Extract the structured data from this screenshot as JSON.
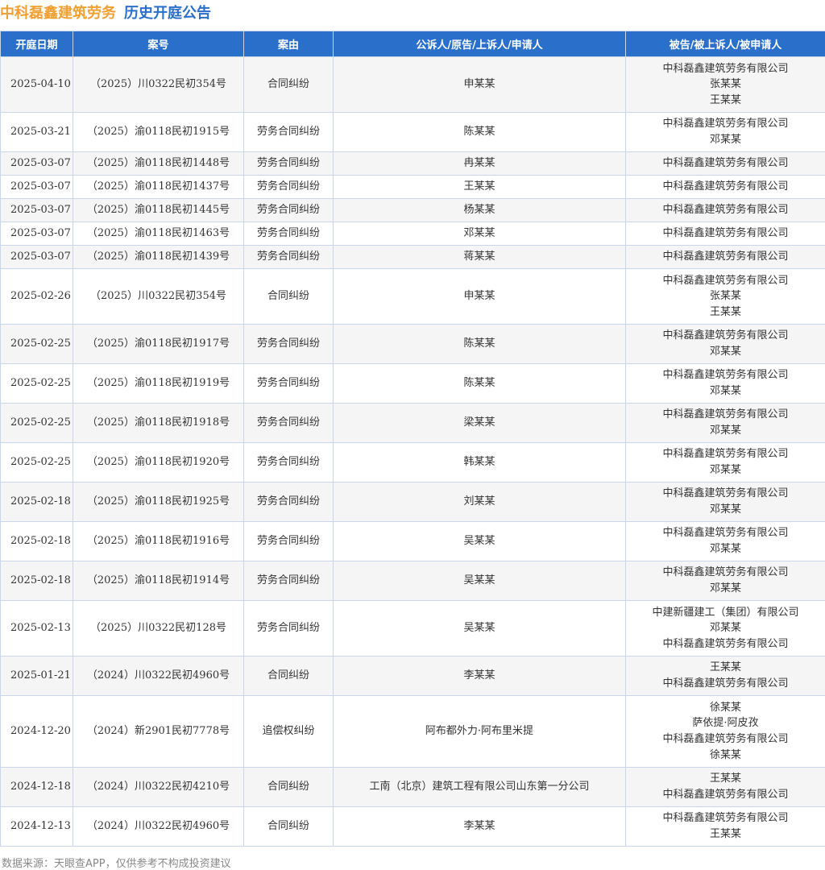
{
  "header": {
    "company": "中科磊鑫建筑劳务",
    "heading": "历史开庭公告"
  },
  "table": {
    "columns": [
      "开庭日期",
      "案号",
      "案由",
      "公诉人/原告/上诉人/申请人",
      "被告/被上诉人/被申请人"
    ],
    "rows": [
      {
        "date": "2025-04-10",
        "case_no": "（2025）川0322民初354号",
        "cause": "合同纠纷",
        "plaintiff": "申某某",
        "defendants": [
          "中科磊鑫建筑劳务有限公司",
          "张某某",
          "王某某"
        ]
      },
      {
        "date": "2025-03-21",
        "case_no": "（2025）渝0118民初1915号",
        "cause": "劳务合同纠纷",
        "plaintiff": "陈某某",
        "defendants": [
          "中科磊鑫建筑劳务有限公司",
          "邓某某"
        ]
      },
      {
        "date": "2025-03-07",
        "case_no": "（2025）渝0118民初1448号",
        "cause": "劳务合同纠纷",
        "plaintiff": "冉某某",
        "defendants": [
          "中科磊鑫建筑劳务有限公司"
        ]
      },
      {
        "date": "2025-03-07",
        "case_no": "（2025）渝0118民初1437号",
        "cause": "劳务合同纠纷",
        "plaintiff": "王某某",
        "defendants": [
          "中科磊鑫建筑劳务有限公司"
        ]
      },
      {
        "date": "2025-03-07",
        "case_no": "（2025）渝0118民初1445号",
        "cause": "劳务合同纠纷",
        "plaintiff": "杨某某",
        "defendants": [
          "中科磊鑫建筑劳务有限公司"
        ]
      },
      {
        "date": "2025-03-07",
        "case_no": "（2025）渝0118民初1463号",
        "cause": "劳务合同纠纷",
        "plaintiff": "邓某某",
        "defendants": [
          "中科磊鑫建筑劳务有限公司"
        ]
      },
      {
        "date": "2025-03-07",
        "case_no": "（2025）渝0118民初1439号",
        "cause": "劳务合同纠纷",
        "plaintiff": "蒋某某",
        "defendants": [
          "中科磊鑫建筑劳务有限公司"
        ]
      },
      {
        "date": "2025-02-26",
        "case_no": "（2025）川0322民初354号",
        "cause": "合同纠纷",
        "plaintiff": "申某某",
        "defendants": [
          "中科磊鑫建筑劳务有限公司",
          "张某某",
          "王某某"
        ]
      },
      {
        "date": "2025-02-25",
        "case_no": "（2025）渝0118民初1917号",
        "cause": "劳务合同纠纷",
        "plaintiff": "陈某某",
        "defendants": [
          "中科磊鑫建筑劳务有限公司",
          "邓某某"
        ]
      },
      {
        "date": "2025-02-25",
        "case_no": "（2025）渝0118民初1919号",
        "cause": "劳务合同纠纷",
        "plaintiff": "陈某某",
        "defendants": [
          "中科磊鑫建筑劳务有限公司",
          "邓某某"
        ]
      },
      {
        "date": "2025-02-25",
        "case_no": "（2025）渝0118民初1918号",
        "cause": "劳务合同纠纷",
        "plaintiff": "梁某某",
        "defendants": [
          "中科磊鑫建筑劳务有限公司",
          "邓某某"
        ]
      },
      {
        "date": "2025-02-25",
        "case_no": "（2025）渝0118民初1920号",
        "cause": "劳务合同纠纷",
        "plaintiff": "韩某某",
        "defendants": [
          "中科磊鑫建筑劳务有限公司",
          "邓某某"
        ]
      },
      {
        "date": "2025-02-18",
        "case_no": "（2025）渝0118民初1925号",
        "cause": "劳务合同纠纷",
        "plaintiff": "刘某某",
        "defendants": [
          "中科磊鑫建筑劳务有限公司",
          "邓某某"
        ]
      },
      {
        "date": "2025-02-18",
        "case_no": "（2025）渝0118民初1916号",
        "cause": "劳务合同纠纷",
        "plaintiff": "吴某某",
        "defendants": [
          "中科磊鑫建筑劳务有限公司",
          "邓某某"
        ]
      },
      {
        "date": "2025-02-18",
        "case_no": "（2025）渝0118民初1914号",
        "cause": "劳务合同纠纷",
        "plaintiff": "吴某某",
        "defendants": [
          "中科磊鑫建筑劳务有限公司",
          "邓某某"
        ]
      },
      {
        "date": "2025-02-13",
        "case_no": "（2025）川0322民初128号",
        "cause": "劳务合同纠纷",
        "plaintiff": "吴某某",
        "defendants": [
          "中建新疆建工（集团）有限公司",
          "邓某某",
          "中科磊鑫建筑劳务有限公司"
        ]
      },
      {
        "date": "2025-01-21",
        "case_no": "（2024）川0322民初4960号",
        "cause": "合同纠纷",
        "plaintiff": "李某某",
        "defendants": [
          "王某某",
          "中科磊鑫建筑劳务有限公司"
        ]
      },
      {
        "date": "2024-12-20",
        "case_no": "（2024）新2901民初7778号",
        "cause": "追偿权纠纷",
        "plaintiff": "阿布都外力·阿布里米提",
        "defendants": [
          "徐某某",
          "萨依提·阿皮孜",
          "中科磊鑫建筑劳务有限公司",
          "徐某某"
        ]
      },
      {
        "date": "2024-12-18",
        "case_no": "（2024）川0322民初4210号",
        "cause": "合同纠纷",
        "plaintiff": "工南（北京）建筑工程有限公司山东第一分公司",
        "defendants": [
          "王某某",
          "中科磊鑫建筑劳务有限公司"
        ]
      },
      {
        "date": "2024-12-13",
        "case_no": "（2024）川0322民初4960号",
        "cause": "合同纠纷",
        "plaintiff": "李某某",
        "defendants": [
          "中科磊鑫建筑劳务有限公司",
          "王某某"
        ]
      }
    ]
  },
  "footer": {
    "source": "数据来源：天眼查APP，仅供参考不构成投资建议"
  }
}
